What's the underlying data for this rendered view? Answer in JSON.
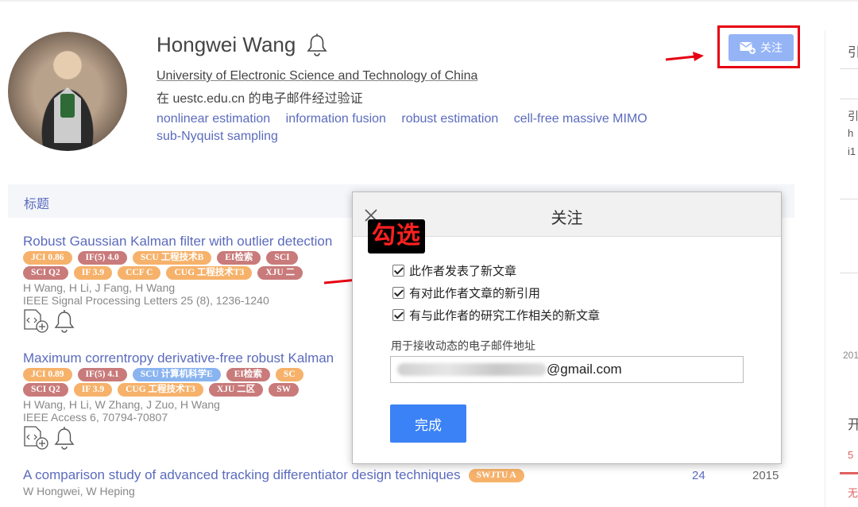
{
  "profile": {
    "name": "Hongwei Wang",
    "affiliation": "University of Electronic Science and Technology of China",
    "verified_email": "在 uestc.edu.cn 的电子邮件经过验证",
    "interests": [
      "nonlinear estimation",
      "information fusion",
      "robust estimation",
      "cell-free massive MIMO",
      "sub-Nyquist sampling"
    ]
  },
  "follow_button": {
    "label": "关注",
    "icon": "envelope-plus-icon"
  },
  "table": {
    "header_title": "标题"
  },
  "articles": [
    {
      "title": "Robust Gaussian Kalman filter with outlier detection",
      "badges_row1": [
        {
          "text": "JCI 0.86",
          "color": "orange"
        },
        {
          "text": "IF(5) 4.0",
          "color": "red"
        },
        {
          "text": "SCU 工程技术B",
          "color": "orange"
        },
        {
          "text": "EI检索",
          "color": "red"
        },
        {
          "text": "SCI",
          "color": "red"
        }
      ],
      "badges_row2": [
        {
          "text": "SCI Q2",
          "color": "red"
        },
        {
          "text": "IF 3.9",
          "color": "orange"
        },
        {
          "text": "CCF C",
          "color": "orange"
        },
        {
          "text": "CUG 工程技术T3",
          "color": "orange"
        },
        {
          "text": "XJU 二",
          "color": "red"
        }
      ],
      "authors": "H Wang, H Li, J Fang, H Wang",
      "venue": "IEEE Signal Processing Letters 25 (8), 1236-1240"
    },
    {
      "title": "Maximum correntropy derivative-free robust Kalman",
      "badges_row1": [
        {
          "text": "JCI 0.89",
          "color": "orange"
        },
        {
          "text": "IF(5) 4.1",
          "color": "red"
        },
        {
          "text": "SCU 计算机科学E",
          "color": "blue"
        },
        {
          "text": "EI检索",
          "color": "red"
        },
        {
          "text": "SC",
          "color": "orange"
        }
      ],
      "badges_row2": [
        {
          "text": "SCI Q2",
          "color": "red"
        },
        {
          "text": "IF 3.9",
          "color": "orange"
        },
        {
          "text": "CUG 工程技术T3",
          "color": "orange"
        },
        {
          "text": "XJU 二区",
          "color": "red"
        },
        {
          "text": "SW",
          "color": "red"
        }
      ],
      "authors": "H Wang, H Li, W Zhang, J Zuo, H Wang",
      "venue": "IEEE Access 6, 70794-70807"
    },
    {
      "title": "A comparison study of advanced tracking differentiator design techniques",
      "badge": {
        "text": "SWJTU A",
        "color": "orange"
      },
      "authors": "W Hongwei, W Heping",
      "cites": "24",
      "year": "2015"
    }
  ],
  "right_column": {
    "r1": "引",
    "r2": "引",
    "r3": "h",
    "r4": "i1",
    "r5": "201",
    "r6": "开",
    "r7": "5",
    "r8": "无"
  },
  "modal": {
    "title": "关注",
    "options": [
      "此作者发表了新文章",
      "有对此作者文章的新引用",
      "有与此作者的研究工作相关的新文章"
    ],
    "email_label": "用于接收动态的电子邮件地址",
    "email_value": "@gmail.com",
    "done_label": "完成"
  },
  "annotation": {
    "text": "勾选"
  },
  "colors": {
    "link": "#5b6bbd",
    "follow_bg": "#95b4f6",
    "highlight": "#e60012",
    "done_bg": "#3b82f6"
  }
}
